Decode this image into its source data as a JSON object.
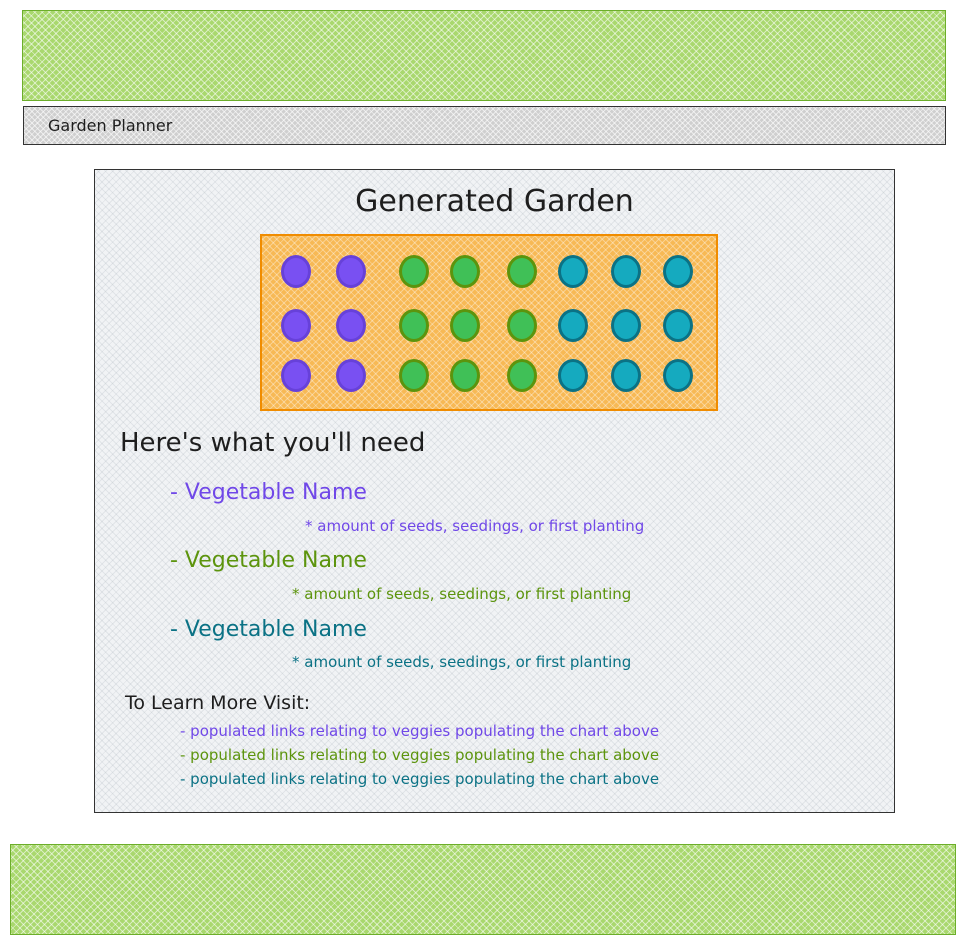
{
  "header": {
    "title": "Garden Planner"
  },
  "main": {
    "title": "Generated Garden",
    "needs_heading": "Here's what you'll need",
    "vegetables": [
      {
        "name": "- Vegetable Name",
        "amount": "* amount of seeds, seedings, or first planting",
        "color": "#7048e8"
      },
      {
        "name": "- Vegetable Name",
        "amount": "* amount of seeds, seedings, or first planting",
        "color": "#5c940d"
      },
      {
        "name": "- Vegetable Name",
        "amount": "* amount of seeds, seedings, or first planting",
        "color": "#0b7285"
      }
    ],
    "learn_heading": "To Learn More Visit:",
    "links": [
      {
        "text": "- populated links relating to veggies populating the chart above",
        "color": "#7048e8"
      },
      {
        "text": "- populated links relating to veggies populating the chart above",
        "color": "#5c940d"
      },
      {
        "text": "- populated links relating to veggies populating the chart above",
        "color": "#0b7285"
      }
    ]
  },
  "garden": {
    "rows": 3,
    "columns": [
      {
        "fill": "#7950f2",
        "stroke": "#6741d9"
      },
      {
        "fill": "#7950f2",
        "stroke": "#6741d9"
      },
      {
        "fill": "#40c057",
        "stroke": "#5c940d"
      },
      {
        "fill": "#40c057",
        "stroke": "#5c940d"
      },
      {
        "fill": "#40c057",
        "stroke": "#5c940d"
      },
      {
        "fill": "#15aabf",
        "stroke": "#0b7285"
      },
      {
        "fill": "#15aabf",
        "stroke": "#0b7285"
      },
      {
        "fill": "#15aabf",
        "stroke": "#0b7285"
      }
    ]
  },
  "colors": {
    "banner": "#a9d86e",
    "plot": "#f7b955",
    "plot_border": "#f08c00"
  }
}
